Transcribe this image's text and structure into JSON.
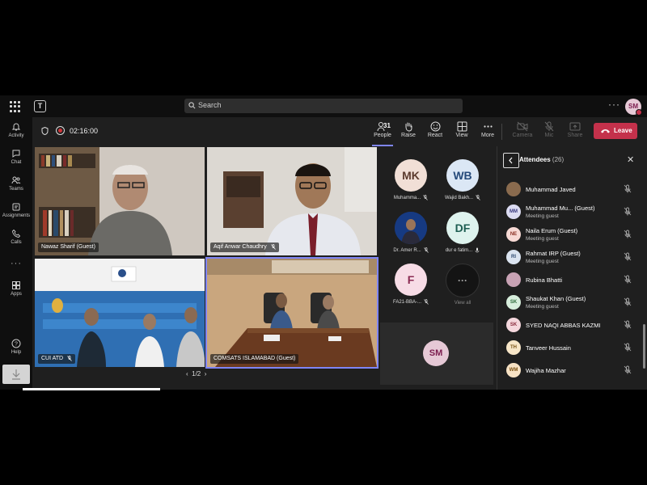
{
  "titlebar": {
    "search_placeholder": "Search",
    "user_initials": "SM"
  },
  "rail": [
    {
      "label": "Activity",
      "icon": "bell-icon"
    },
    {
      "label": "Chat",
      "icon": "chat-icon"
    },
    {
      "label": "Teams",
      "icon": "teams-icon"
    },
    {
      "label": "Assignments",
      "icon": "assignments-icon"
    },
    {
      "label": "Calls",
      "icon": "phone-icon"
    },
    {
      "label": "Apps",
      "icon": "apps-icon"
    },
    {
      "label": "Help",
      "icon": "help-icon"
    }
  ],
  "meeting": {
    "timer": "02:16:00",
    "people_count": "31",
    "controls": [
      {
        "label": "People",
        "icon": "people-icon"
      },
      {
        "label": "Raise",
        "icon": "raise-hand-icon"
      },
      {
        "label": "React",
        "icon": "react-icon"
      },
      {
        "label": "View",
        "icon": "view-icon"
      },
      {
        "label": "More",
        "icon": "more-icon"
      },
      {
        "label": "Camera",
        "icon": "camera-off-icon"
      },
      {
        "label": "Mic",
        "icon": "mic-off-icon"
      },
      {
        "label": "Share",
        "icon": "share-icon"
      }
    ],
    "leave_label": "Leave",
    "pager": "1/2"
  },
  "videos": [
    {
      "label": "Nawaz Sharif (Guest)"
    },
    {
      "label": "Aqif Anwar Chaudhry"
    },
    {
      "label": "CUI ATD"
    },
    {
      "label": "COMSATS ISLAMABAD (Guest)"
    }
  ],
  "tiles": [
    {
      "initials": "MK",
      "name": "Muhamma...",
      "bg": "#f1dfd6",
      "fg": "#5c3b2e"
    },
    {
      "initials": "WB",
      "name": "Wajid Bakh...",
      "bg": "#dbe7f5",
      "fg": "#254a7a"
    },
    {
      "initials": "",
      "name": "Dr. Amer R...",
      "bg": "#1b3f8a",
      "fg": "#ffffff"
    },
    {
      "initials": "DF",
      "name": "dur e fatim...",
      "bg": "#def3ee",
      "fg": "#1d5e52"
    },
    {
      "initials": "F",
      "name": "FA21-BBA-...",
      "bg": "#f7dce6",
      "fg": "#8a2a52"
    },
    {
      "initials": "···",
      "name": "View all",
      "bg": "#141414",
      "fg": "#aaaaaa"
    }
  ],
  "self_tile": {
    "initials": "SM"
  },
  "attendees": {
    "title": "Attendees",
    "count": "(26)",
    "list": [
      {
        "name": "Muhammad Javed",
        "sub": "",
        "initials": "",
        "bg": "#8a6b4e",
        "fg": "#ffffff"
      },
      {
        "name": "Muhammad Mu...  (Guest)",
        "sub": "Meeting guest",
        "initials": "MM",
        "bg": "#dcdcf2",
        "fg": "#3b3b80"
      },
      {
        "name": "Naila Erum (Guest)",
        "sub": "Meeting guest",
        "initials": "NE",
        "bg": "#f7d9d4",
        "fg": "#8a2e22"
      },
      {
        "name": "Rahmat IRP (Guest)",
        "sub": "Meeting guest",
        "initials": "RI",
        "bg": "#dbe4f0",
        "fg": "#2f4b70"
      },
      {
        "name": "Rubina Bhatti",
        "sub": "",
        "initials": "",
        "bg": "#c8a2b4",
        "fg": "#ffffff"
      },
      {
        "name": "Shaukat Khan (Guest)",
        "sub": "Meeting guest",
        "initials": "SK",
        "bg": "#d7eedc",
        "fg": "#2d6b3a"
      },
      {
        "name": "SYED NAQI ABBAS KAZMI",
        "sub": "",
        "initials": "SK",
        "bg": "#f5d7dd",
        "fg": "#8a2a3c"
      },
      {
        "name": "Tanveer Hussain",
        "sub": "",
        "initials": "TH",
        "bg": "#f7e6c8",
        "fg": "#7a5416"
      },
      {
        "name": "Wajiha Mazhar",
        "sub": "",
        "initials": "WM",
        "bg": "#f7e2c4",
        "fg": "#7a4f10"
      }
    ]
  }
}
